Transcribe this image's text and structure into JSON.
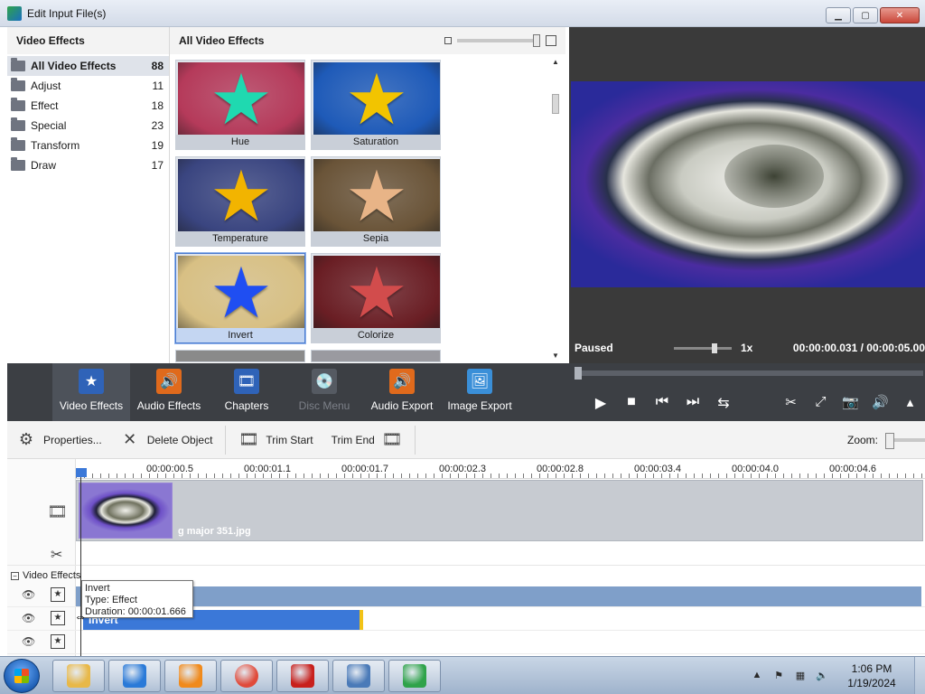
{
  "window": {
    "title": "Edit Input File(s)",
    "controls": [
      "▁",
      "▢",
      "✕"
    ]
  },
  "categories": {
    "header": "Video Effects",
    "items": [
      {
        "label": "All Video Effects",
        "count": "88",
        "active": true
      },
      {
        "label": "Adjust",
        "count": "11"
      },
      {
        "label": "Effect",
        "count": "18"
      },
      {
        "label": "Special",
        "count": "23"
      },
      {
        "label": "Transform",
        "count": "19"
      },
      {
        "label": "Draw",
        "count": "17"
      }
    ]
  },
  "gallery": {
    "header": "All Video Effects",
    "effects": [
      {
        "label": "Hue",
        "bg": "#b53a5a",
        "star": "#1fd9b0"
      },
      {
        "label": "Saturation",
        "bg": "#1e5ab8",
        "star": "#f2c400"
      },
      {
        "label": "Temperature",
        "bg": "#3a4580",
        "star": "#f2b400"
      },
      {
        "label": "Sepia",
        "bg": "#6a5438",
        "star": "#e8b487"
      },
      {
        "label": "Invert",
        "bg": "#d8c084",
        "star": "#1f4ef2",
        "selected": true
      },
      {
        "label": "Colorize",
        "bg": "#6a1e24",
        "star": "#d24c4c"
      }
    ]
  },
  "preview": {
    "status": "Paused",
    "speed": "1x",
    "time": "00:00:00.031 / 00:00:05.00"
  },
  "tools": [
    {
      "label": "Video Effects",
      "icon": "video-effects-icon",
      "glyph": "★",
      "color": "#2f63b8",
      "active": true
    },
    {
      "label": "Audio Effects",
      "icon": "audio-effects-icon",
      "glyph": "🔊",
      "color": "#e06a1c"
    },
    {
      "label": "Chapters",
      "icon": "chapters-icon",
      "glyph": "🎞",
      "color": "#2f63b8"
    },
    {
      "label": "Disc Menu",
      "icon": "disc-menu-icon",
      "glyph": "💿",
      "color": "#555a62",
      "disabled": true
    },
    {
      "label": "Audio Export",
      "icon": "audio-export-icon",
      "glyph": "🔊",
      "color": "#e06a1c"
    },
    {
      "label": "Image Export",
      "icon": "image-export-icon",
      "glyph": "🖼",
      "color": "#3a8fd8"
    }
  ],
  "player": {
    "controls": [
      "▶",
      "■",
      "⏮",
      "⏭",
      "⇆"
    ],
    "right_controls": [
      "✂",
      "⤢",
      "📷",
      "🔊",
      "▴"
    ]
  },
  "actions": {
    "properties": "Properties...",
    "delete": "Delete Object",
    "trim_start": "Trim Start",
    "trim_end": "Trim End",
    "zoom": "Zoom:"
  },
  "timeline": {
    "ruler": [
      "00:00:00.5",
      "00:00:01.1",
      "00:00:01.7",
      "00:00:02.3",
      "00:00:02.8",
      "00:00:03.4",
      "00:00:04.0",
      "00:00:04.6"
    ],
    "clip_name": "g major 351.jpg",
    "video_effects_label": "Video Effects",
    "effect_bar_label": "Invert"
  },
  "tooltip": {
    "name": "Invert",
    "type": "Type: Effect",
    "duration": "Duration:  00:00:01.666"
  },
  "taskbar": {
    "apps": [
      {
        "name": "explorer",
        "color": "#e8b848"
      },
      {
        "name": "internet-explorer",
        "color": "#2a7ad8"
      },
      {
        "name": "media-player",
        "color": "#f08a1c"
      },
      {
        "name": "chrome",
        "color": "#e04a3a"
      },
      {
        "name": "app-red",
        "color": "#c8201c"
      },
      {
        "name": "control-panel",
        "color": "#4a7ab8"
      },
      {
        "name": "video-editor",
        "color": "#2fa34a"
      }
    ],
    "time": "1:06 PM",
    "date": "1/19/2024"
  }
}
